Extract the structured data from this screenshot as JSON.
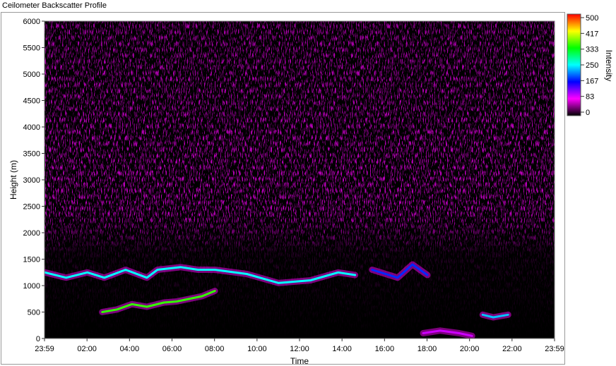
{
  "window": {
    "title": "Ceilometer Backscatter Profile"
  },
  "chart_data": {
    "type": "heatmap",
    "title": "Ceilometer Backscatter Profile",
    "xlabel": "Time",
    "ylabel": "Height (m)",
    "x_ticks": [
      "23:59",
      "02:00",
      "04:00",
      "06:00",
      "08:00",
      "10:00",
      "12:00",
      "14:00",
      "16:00",
      "18:00",
      "20:00",
      "22:00",
      "23:59"
    ],
    "y_ticks": [
      "0",
      "500",
      "1000",
      "1500",
      "2000",
      "2500",
      "3000",
      "3500",
      "4000",
      "4500",
      "5000",
      "5500",
      "6000"
    ],
    "ylim": [
      0,
      6000
    ],
    "x_range_hours": [
      -0.0167,
      23.9833
    ],
    "colorbar": {
      "label": "Intensity",
      "ticks": [
        "500",
        "417",
        "333",
        "250",
        "167",
        "83",
        "0"
      ],
      "range": [
        0,
        500
      ],
      "colors": [
        "#000000",
        "#ff00ff",
        "#0000ff",
        "#00ffff",
        "#00ff00",
        "#ffff00",
        "#ff0000"
      ]
    },
    "background_color": "#000000",
    "layers": [
      {
        "name": "cloud-base-layer",
        "points": [
          [
            0.0,
            1250
          ],
          [
            1.0,
            1150
          ],
          [
            2.0,
            1250
          ],
          [
            2.8,
            1150
          ],
          [
            3.8,
            1300
          ],
          [
            4.8,
            1150
          ],
          [
            5.3,
            1300
          ],
          [
            6.4,
            1350
          ],
          [
            7.2,
            1300
          ],
          [
            8.0,
            1300
          ],
          [
            9.5,
            1220
          ],
          [
            11.0,
            1050
          ],
          [
            12.5,
            1100
          ],
          [
            13.8,
            1250
          ],
          [
            14.6,
            1200
          ]
        ],
        "intensity": 250
      },
      {
        "name": "lower-cloud-patches",
        "points": [
          [
            2.7,
            500
          ],
          [
            3.4,
            550
          ],
          [
            4.1,
            650
          ],
          [
            4.8,
            600
          ],
          [
            5.6,
            680
          ],
          [
            6.2,
            700
          ],
          [
            7.4,
            800
          ],
          [
            8.0,
            900
          ]
        ],
        "intensity": 350
      },
      {
        "name": "evening-layer",
        "points": [
          [
            15.4,
            1300
          ],
          [
            16.6,
            1150
          ],
          [
            17.3,
            1400
          ],
          [
            18.0,
            1200
          ]
        ],
        "intensity": 180
      },
      {
        "name": "surface-precipitation",
        "points": [
          [
            17.8,
            100
          ],
          [
            18.6,
            150
          ],
          [
            19.5,
            100
          ],
          [
            20.1,
            50
          ]
        ],
        "intensity": 100
      },
      {
        "name": "late-evening-patch",
        "points": [
          [
            20.6,
            450
          ],
          [
            21.1,
            400
          ],
          [
            21.8,
            450
          ]
        ],
        "intensity": 230
      }
    ]
  }
}
